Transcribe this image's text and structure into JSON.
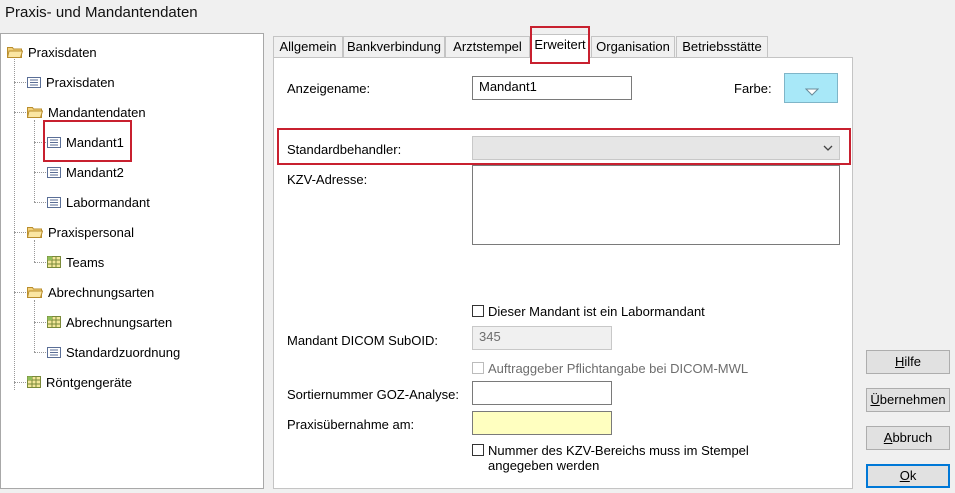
{
  "window": {
    "title": "Praxis- und Mandantendaten"
  },
  "tree": {
    "items": [
      {
        "label": "Praxisdaten",
        "icon": "folder-open-icon"
      },
      {
        "label": "Praxisdaten",
        "icon": "list-icon"
      },
      {
        "label": "Mandantendaten",
        "icon": "folder-open-icon"
      },
      {
        "label": "Mandant1",
        "icon": "list-icon",
        "selected": true
      },
      {
        "label": "Mandant2",
        "icon": "list-icon"
      },
      {
        "label": "Labormandant",
        "icon": "list-icon"
      },
      {
        "label": "Praxispersonal",
        "icon": "folder-open-icon"
      },
      {
        "label": "Teams",
        "icon": "grid-icon"
      },
      {
        "label": "Abrechnungsarten",
        "icon": "folder-open-icon"
      },
      {
        "label": "Abrechnungsarten",
        "icon": "grid-icon"
      },
      {
        "label": "Standardzuordnung",
        "icon": "list-icon"
      },
      {
        "label": "Röntgengeräte",
        "icon": "grid-icon"
      }
    ]
  },
  "tabs": [
    {
      "label": "Allgemein"
    },
    {
      "label": "Bankverbindung"
    },
    {
      "label": "Arztstempel"
    },
    {
      "label": "Erweitert",
      "active": true
    },
    {
      "label": "Organisation"
    },
    {
      "label": "Betriebsstätte"
    }
  ],
  "form": {
    "anzeigename_label": "Anzeigename:",
    "anzeigename_value": "Mandant1",
    "farbe_label": "Farbe:",
    "farbe_color": "#a8e8f8",
    "standardbehandler_label": "Standardbehandler:",
    "standardbehandler_value": "",
    "kzv_label": "KZV-Adresse:",
    "kzv_value": "",
    "labormandant_checkbox": "Dieser Mandant ist ein Labormandant",
    "dicom_label": "Mandant DICOM SubOID:",
    "dicom_value": "345",
    "auftraggeber_checkbox": "Auftraggeber Pflichtangabe bei DICOM-MWL",
    "sortier_label": "Sortiernummer GOZ-Analyse:",
    "sortier_value": "",
    "praxisuebernahme_label": "Praxisübernahme am:",
    "praxisuebernahme_value": "",
    "kzv_stempel_checkbox_line1": "Nummer des KZV-Bereichs muss im Stempel",
    "kzv_stempel_checkbox_line2": "angegeben werden"
  },
  "buttons": {
    "hilfe_first": "H",
    "hilfe_rest": "ilfe",
    "uebernehmen_first": "Ü",
    "uebernehmen_rest": "bernehmen",
    "abbruch_first": "A",
    "abbruch_rest": "bbruch",
    "ok_first": "O",
    "ok_rest": "k"
  },
  "colors": {
    "highlight": "#c8202f",
    "focus": "#0078d7"
  }
}
